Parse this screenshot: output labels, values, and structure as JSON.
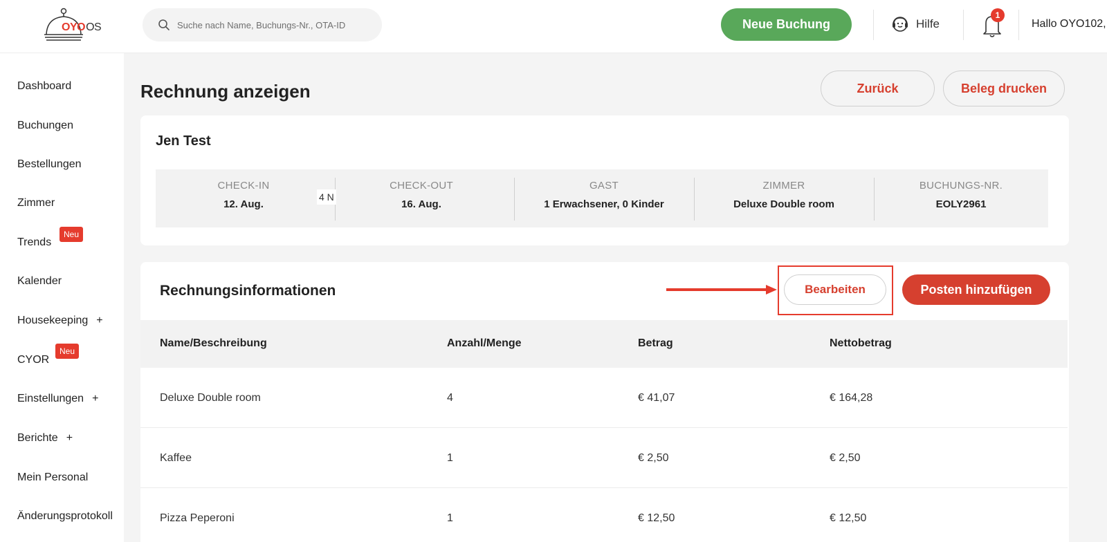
{
  "header": {
    "logo": {
      "oyo": "OYO",
      "os": "OS"
    },
    "search_placeholder": "Suche nach Name, Buchungs-Nr., OTA-ID",
    "new_booking": "Neue Buchung",
    "help": "Hilfe",
    "notifications_count": "1",
    "greeting": "Hallo OYO102,"
  },
  "sidebar": {
    "items": [
      {
        "label": "Dashboard"
      },
      {
        "label": "Buchungen"
      },
      {
        "label": "Bestellungen"
      },
      {
        "label": "Zimmer"
      },
      {
        "label": "Trends",
        "badge": "Neu"
      },
      {
        "label": "Kalender"
      },
      {
        "label": "Housekeeping",
        "plus": "+"
      },
      {
        "label": "CYOR",
        "badge": "Neu"
      },
      {
        "label": "Einstellungen",
        "plus": "+"
      },
      {
        "label": "Berichte",
        "plus": "+"
      },
      {
        "label": "Mein Personal"
      },
      {
        "label": "Änderungsprotokoll"
      }
    ]
  },
  "page": {
    "title": "Rechnung anzeigen",
    "back": "Zurück",
    "print": "Beleg drucken"
  },
  "booking": {
    "guest_name": "Jen Test",
    "nights": "4 N",
    "fields": [
      {
        "label": "CHECK-IN",
        "value": "12. Aug."
      },
      {
        "label": "CHECK-OUT",
        "value": "16. Aug."
      },
      {
        "label": "GAST",
        "value": "1 Erwachsener, 0 Kinder"
      },
      {
        "label": "ZIMMER",
        "value": "Deluxe Double room"
      },
      {
        "label": "BUCHUNGS-NR.",
        "value": "EOLY2961"
      }
    ]
  },
  "invoice": {
    "title": "Rechnungsinformationen",
    "edit": "Bearbeiten",
    "add_item": "Posten hinzufügen",
    "columns": [
      "Name/Beschreibung",
      "Anzahl/Menge",
      "Betrag",
      "Nettobetrag"
    ],
    "rows": [
      [
        "Deluxe Double room",
        "4",
        "€ 41,07",
        "€ 164,28"
      ],
      [
        "Kaffee",
        "1",
        "€ 2,50",
        "€ 2,50"
      ],
      [
        "Pizza Peperoni",
        "1",
        "€ 12,50",
        "€ 12,50"
      ]
    ]
  },
  "colors": {
    "accent": "#e53b2d",
    "primary_green": "#59a85a"
  },
  "icons": [
    "search-icon",
    "help-icon",
    "bell-icon",
    "cloche-icon",
    "arrow-icon"
  ]
}
